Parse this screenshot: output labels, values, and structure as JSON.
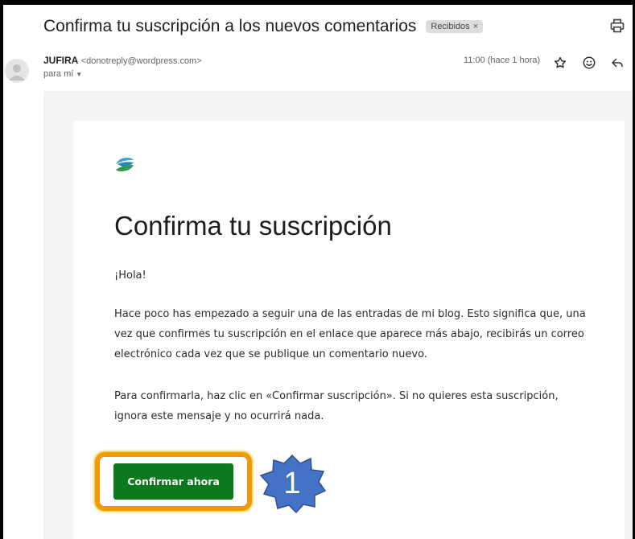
{
  "email": {
    "subject": "Confirma tu suscripción a los nuevos comentarios",
    "label": "Recibidos",
    "label_close": "×",
    "sender_name": "JUFIRA",
    "sender_email": "<donotreply@wordpress.com>",
    "to": "para mí",
    "time": "11:00 (hace 1 hora)"
  },
  "body": {
    "heading": "Confirma tu suscripción",
    "greeting": "¡Hola!",
    "paragraph1": "Hace poco has empezado a seguir una de las entradas de mi blog. Esto significa que, una vez que confirmes tu suscripción en el enlace que aparece más abajo, recibirás un correo electrónico cada vez que se publique un comentario nuevo.",
    "paragraph2": "Para confirmarla, haz clic en «Confirmar suscripción». Si no quieres esta suscripción, ignora este mensaje y no ocurrirá nada.",
    "button_label": "Confirmar ahora"
  },
  "annotation": {
    "step_number": "1",
    "badge_color": "#4472c4",
    "highlight_color": "#e8a000"
  },
  "colors": {
    "button": "#0b7a1f",
    "background": "#f3f3f3"
  },
  "icons": [
    "print-icon",
    "star-icon",
    "emoji-icon",
    "reply-icon",
    "avatar-icon",
    "site-logo-icon"
  ]
}
